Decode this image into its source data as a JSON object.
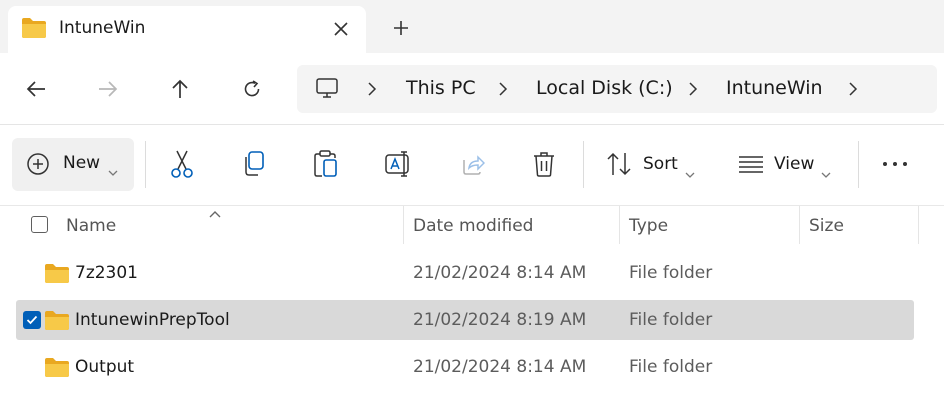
{
  "tab": {
    "title": "IntuneWin",
    "close_icon": "close-icon",
    "new_tab_icon": "plus-icon"
  },
  "navigation": {
    "buttons": [
      "back-arrow-icon",
      "forward-arrow-icon",
      "up-arrow-icon",
      "refresh-icon"
    ],
    "breadcrumbs": [
      "This PC",
      "Local Disk (C:)",
      "IntuneWin"
    ]
  },
  "toolbar": {
    "new_label": "New",
    "sort_label": "Sort",
    "view_label": "View",
    "icons": [
      "cut-icon",
      "copy-icon",
      "paste-icon",
      "rename-icon",
      "share-icon",
      "delete-icon",
      "more-icon"
    ]
  },
  "columns": {
    "name": "Name",
    "date": "Date modified",
    "type": "Type",
    "size": "Size"
  },
  "files": [
    {
      "name": "7z2301",
      "date": "21/02/2024 8:14 AM",
      "type": "File folder",
      "selected": false
    },
    {
      "name": "IntunewinPrepTool",
      "date": "21/02/2024 8:19 AM",
      "type": "File folder",
      "selected": true
    },
    {
      "name": "Output",
      "date": "21/02/2024 8:14 AM",
      "type": "File folder",
      "selected": false
    }
  ],
  "colors": {
    "accent": "#005fb8",
    "folder": "#f4c24c",
    "selected_row": "#d9d9d9"
  }
}
